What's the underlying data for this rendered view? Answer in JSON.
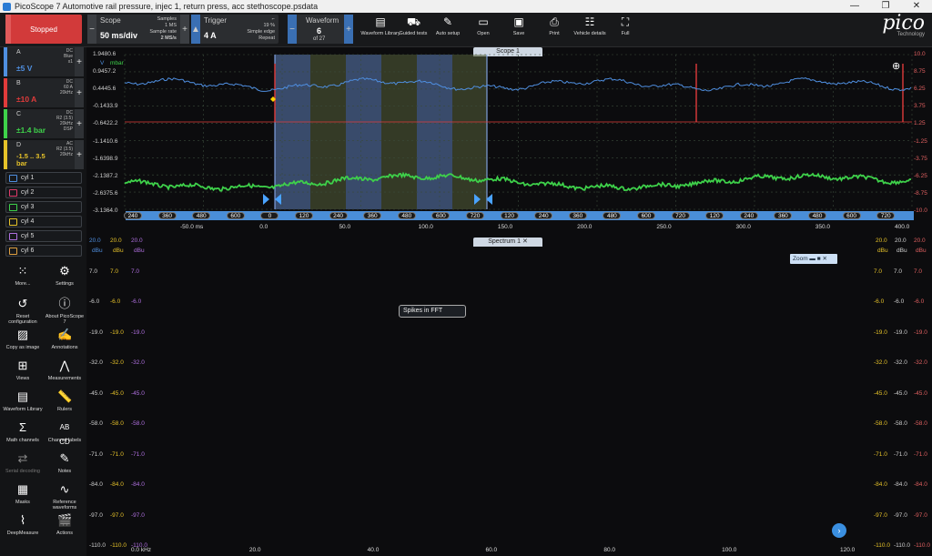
{
  "window": {
    "title": "PicoScope 7 Automotive rail pressure, injec 1, return press, acc stethoscope.psdata",
    "controls": [
      "—",
      "❐",
      "✕"
    ]
  },
  "toolbar": {
    "run_state": "Stopped",
    "scope": {
      "label": "Scope",
      "timebase": "50 ms/div",
      "samples_label": "Samples",
      "samples": "1 MS",
      "rate_label": "Sample rate",
      "rate": "2 MS/s"
    },
    "trigger": {
      "label": "Trigger",
      "level": "4 A",
      "percent": "19 %",
      "mode1": "Simple edge",
      "mode2": "Repeat"
    },
    "waveform": {
      "label": "Waveform",
      "current": "6",
      "total": "of 27"
    },
    "buttons": [
      "Waveform Library",
      "Guided tests",
      "Auto setup",
      "Open",
      "Save",
      "Print",
      "Vehicle details",
      "Full"
    ],
    "logo": {
      "word": "pico",
      "sub": "Technology"
    }
  },
  "channels": [
    {
      "id": "A",
      "range": "±5 V",
      "meta": [
        "DC",
        "Blue",
        "x1"
      ],
      "color": "#4f8fe0"
    },
    {
      "id": "B",
      "range": "±10 A",
      "meta": [
        "DC",
        "60 A",
        "20kHz"
      ],
      "color": "#e03b3b"
    },
    {
      "id": "C",
      "range": "±1.4 bar",
      "meta": [
        "DC",
        "R2 (3.5)",
        "20kHz",
        "DSP"
      ],
      "color": "#3ed14a"
    },
    {
      "id": "D",
      "range": "-1.5 .. 3.5 bar",
      "meta": [
        "AC",
        "R2 (3.5)",
        "20kHz"
      ],
      "color": "#e6c229"
    }
  ],
  "math_channels": [
    {
      "label": "cyl 1",
      "color": "#4f8fe0"
    },
    {
      "label": "cyl 2",
      "color": "#e03b6a"
    },
    {
      "label": "cyl 3",
      "color": "#3ed14a"
    },
    {
      "label": "cyl 4",
      "color": "#e6c229"
    },
    {
      "label": "cyl 5",
      "color": "#b070e0"
    },
    {
      "label": "cyl 6",
      "color": "#e0a040"
    }
  ],
  "tools": [
    "More...",
    "Settings",
    "Reset configuration",
    "About PicoScope 7",
    "Copy as image",
    "Annotations",
    "Views",
    "Measurements",
    "Waveform Library",
    "Rulers",
    "Math channels",
    "Channel labels",
    "Serial decoding",
    "Notes",
    "Masks",
    "Reference waveforms",
    "DeepMeasure",
    "Actions"
  ],
  "scope_view": {
    "tab": "Scope 1",
    "unit_v": "V",
    "unit_mbar": "mbar",
    "left_axis": [
      "1.9480.6",
      "0.9457.2",
      "0.4445.6",
      "-0.1433.9",
      "-0.6422.2",
      "-1.1410.6",
      "-1.6398.9",
      "-2.1387.2",
      "-2.6375.6",
      "-3.1364.0"
    ],
    "right_axis": [
      "10.0",
      "8.75",
      "6.25",
      "3.75",
      "1.25",
      "-1.25",
      "-3.75",
      "-6.25",
      "-8.75",
      "-10.0"
    ],
    "time_axis": [
      "-50.0 ms",
      "0.0",
      "50.0",
      "100.0",
      "150.0",
      "200.0",
      "250.0",
      "300.0",
      "350.0",
      "400.0"
    ],
    "crank_ruler": [
      "240",
      "360",
      "480",
      "600",
      "0",
      "120",
      "240",
      "360",
      "480",
      "600",
      "720",
      "120",
      "240",
      "360",
      "480",
      "600",
      "720",
      "120",
      "240",
      "360",
      "480",
      "600",
      "720"
    ]
  },
  "spectrum_view": {
    "tab": "Spectrum 1",
    "unit": "dBu",
    "ref_levels": [
      "20.0",
      "20.0",
      "20.0"
    ],
    "right_ref_levels": [
      "20.0",
      "20.0",
      "20.0"
    ],
    "y_axis": [
      "7.0",
      "-6.0",
      "-19.0",
      "-32.0",
      "-45.0",
      "-58.0",
      "-71.0",
      "-84.0",
      "-97.0",
      "-110.0"
    ],
    "x_axis": [
      "0.0 kHz",
      "20.0",
      "40.0",
      "60.0",
      "80.0",
      "100.0",
      "120.0"
    ],
    "annotation": "Spikes in FFT",
    "zoom_label": "Zoom"
  },
  "icons": {
    "stop": "square-icon",
    "zoom": "magnifier-icon"
  }
}
